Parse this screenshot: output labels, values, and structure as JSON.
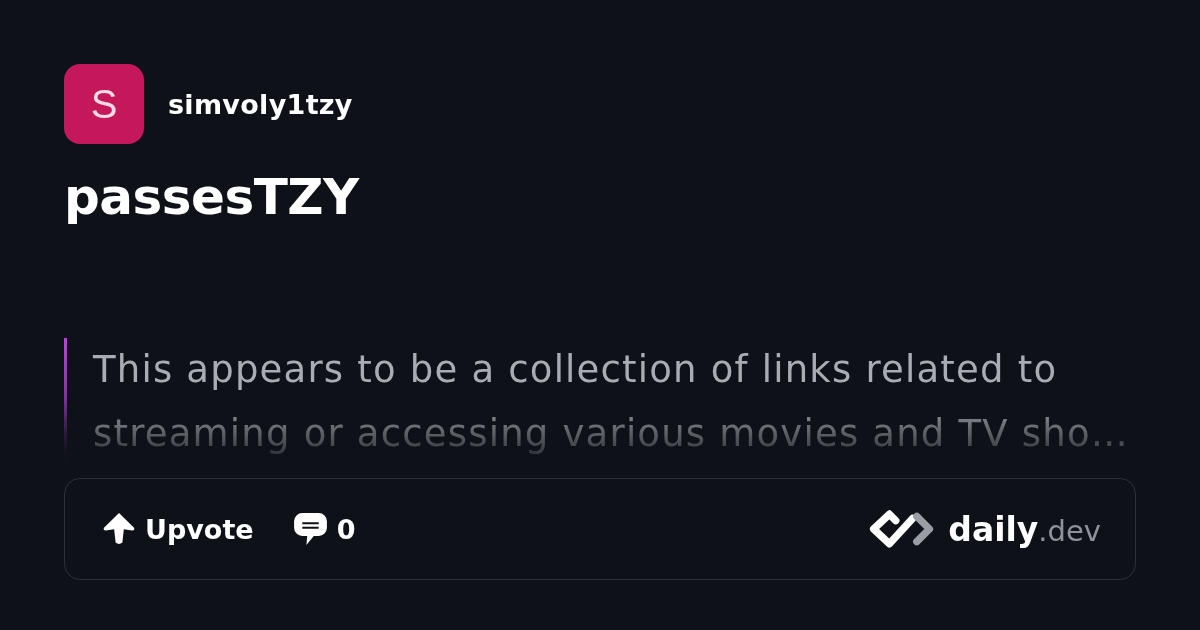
{
  "author": {
    "initial": "S",
    "name": "simvoly1tzy"
  },
  "post": {
    "title": "passesTZY",
    "summary": "This appears to be a collection of links related to streaming or accessing various movies and TV sho…"
  },
  "actions": [
    {
      "kind": "upvote",
      "label": "Upvote"
    },
    {
      "kind": "comments",
      "label": "0"
    }
  ],
  "brand": {
    "wordmark": "**daily**.dev"
  }
}
